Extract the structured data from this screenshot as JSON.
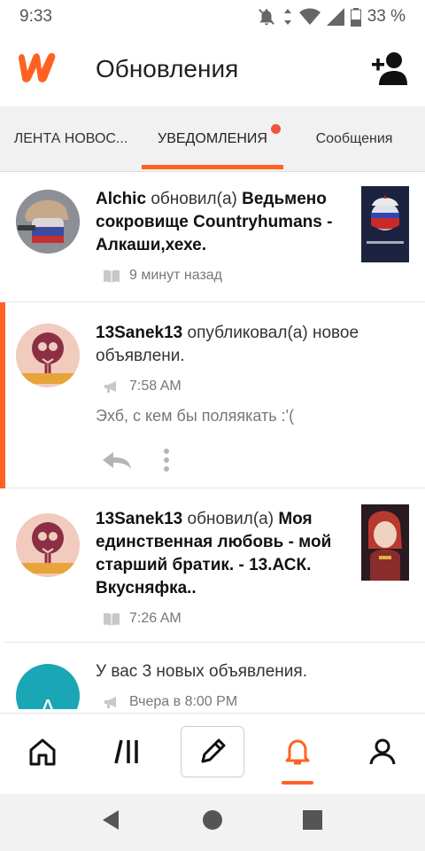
{
  "status_bar": {
    "time": "9:33",
    "battery": "33 %"
  },
  "header": {
    "title": "Обновления",
    "add_user_icon": "add-user-icon"
  },
  "tabs": [
    {
      "label": "ЛЕНТА НОВОС..."
    },
    {
      "label": "УВЕДОМЛЕНИЯ",
      "active": true,
      "has_badge": true
    },
    {
      "label": "Сообщения"
    }
  ],
  "feed": [
    {
      "user": "Alchic",
      "action": "обновил(а)",
      "story": "Ведьмено сокровище Countryhumans - Алкаши,хехе.",
      "time": "9 минут назад",
      "meta_icon": "book-icon"
    },
    {
      "user": "13Sanek13",
      "action": "опубликовал(а) новое объявлени.",
      "time": "7:58 AM",
      "meta_icon": "megaphone-icon",
      "message": "Эхб, с кем бы поляякать :'(",
      "highlighted": true
    },
    {
      "user": "13Sanek13",
      "action": "обновил(а)",
      "story": "Моя единственная любовь - мой старший братик. - 13.АСК. Вкусняфка..",
      "time": "7:26 AM",
      "meta_icon": "book-icon"
    },
    {
      "avatar_letter": "A",
      "text": "У вас 3 новых объявления.",
      "time": "Вчера в 8:00 PM",
      "meta_icon": "megaphone-icon"
    }
  ],
  "colors": {
    "accent": "#ff6122",
    "badge": "#f0543c"
  }
}
